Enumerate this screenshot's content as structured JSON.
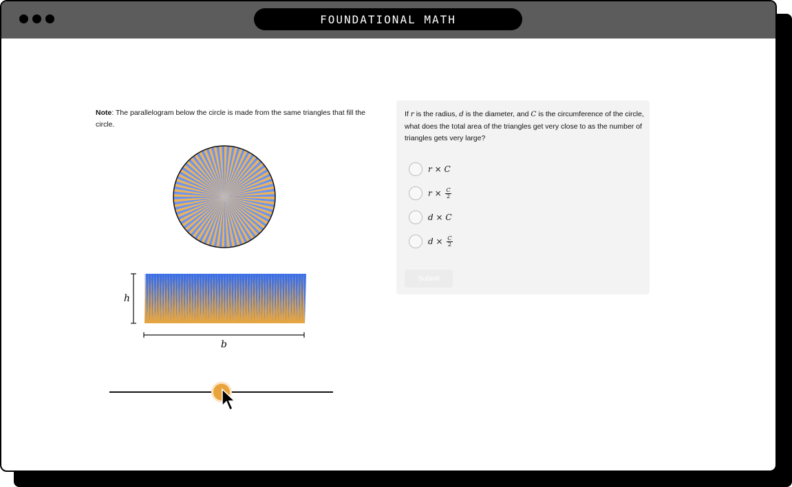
{
  "window": {
    "title": "FOUNDATIONAL MATH"
  },
  "note": {
    "label": "Note",
    "text": ": The parallelogram below the circle is made from the same triangles that fill the circle."
  },
  "diagram": {
    "height_label": "h",
    "base_label": "b",
    "colors": {
      "orange": "#e8a43a",
      "blue": "#3a6fe8"
    }
  },
  "question": {
    "text_parts": [
      "If ",
      "r",
      " is the radius, ",
      "d",
      " is the diameter, and ",
      "C",
      " is the circumference of the circle, what does the total area of the triangles get very close to as the number of triangles gets very large?"
    ],
    "options": [
      {
        "left": "r",
        "op": "×",
        "right": "C",
        "denominator": ""
      },
      {
        "left": "r",
        "op": "×",
        "right": "C",
        "denominator": "2"
      },
      {
        "left": "d",
        "op": "×",
        "right": "C",
        "denominator": ""
      },
      {
        "left": "d",
        "op": "×",
        "right": "C",
        "denominator": "2"
      }
    ],
    "submit_label": "Submit"
  },
  "slider": {
    "value_fraction": 0.5
  }
}
